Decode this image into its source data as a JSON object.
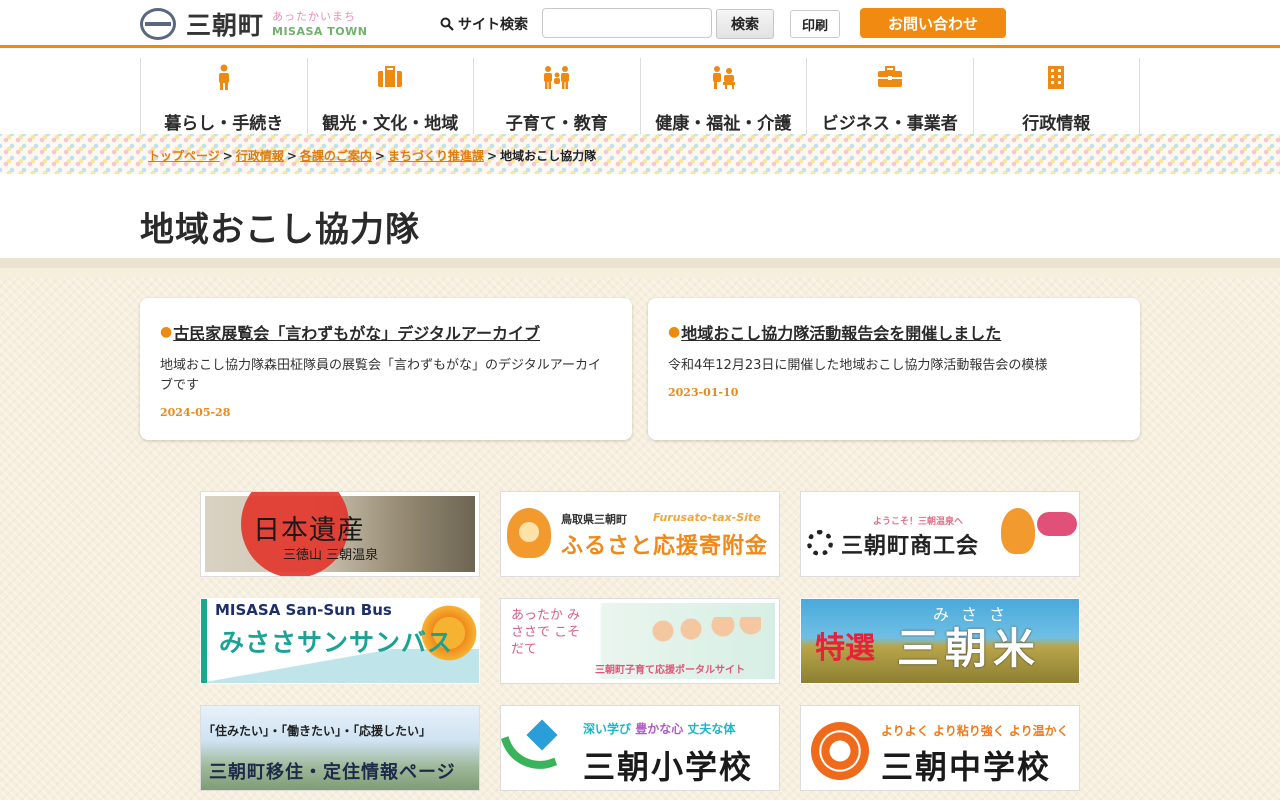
{
  "header": {
    "logo_name": "三朝町",
    "logo_tag_jp": "あったかいまち",
    "logo_tag_en": "MISASA TOWN",
    "search_label": "サイト検索",
    "search_value": "",
    "search_placeholder": "",
    "search_button": "検索",
    "print_button": "印刷",
    "contact_button": "お問い合わせ"
  },
  "gnav": {
    "items": [
      {
        "label": "暮らし・手続き",
        "icon": "person-icon"
      },
      {
        "label": "観光・文化・地域",
        "icon": "suitcase-icon"
      },
      {
        "label": "子育て・教育",
        "icon": "parent-child-icon"
      },
      {
        "label": "健康・福祉・介護",
        "icon": "care-icon"
      },
      {
        "label": "ビジネス・事業者",
        "icon": "briefcase-icon"
      },
      {
        "label": "行政情報",
        "icon": "building-icon"
      }
    ]
  },
  "breadcrumb": {
    "items": [
      "トップページ",
      "行政情報",
      "各課のご案内",
      "まちづくり推進課"
    ],
    "current": "地域おこし協力隊",
    "separator": ">"
  },
  "page": {
    "title": "地域おこし協力隊"
  },
  "cards": [
    {
      "title": "古民家展覧会「言わずもがな」デジタルアーカイブ",
      "description": "地域おこし協力隊森田柾隊員の展覧会「言わずもがな」のデジタルアーカイブです",
      "date": "2024-05-28"
    },
    {
      "title": "地域おこし協力隊活動報告会を開催しました",
      "description": "令和4年12月23日に開催した地域おこし協力隊活動報告会の模様",
      "date": "2023-01-10"
    }
  ],
  "banners": {
    "heritage": {
      "main": "日本遺産",
      "sub": "三徳山 三朝温泉"
    },
    "furusato": {
      "l1": "鳥取県三朝町",
      "l1b": "Furusato-tax-Site",
      "l2": "ふるさと応援寄附金"
    },
    "shoukokai": {
      "top": "ようこそ！三朝温泉へ",
      "name": "三朝町商工会"
    },
    "bus": {
      "en": "MISASA San-Sun Bus",
      "jp": "みささサンサンバス"
    },
    "kosodate": {
      "l": "あったか みささで こそだて",
      "cap": "三朝町子育て応援ポータルサイト"
    },
    "rice": {
      "ruby": "みささ",
      "tok": "特選",
      "main": "三朝米"
    },
    "iju": {
      "l1": "「住みたい」・「働きたい」・「応援したい」",
      "l2": "三朝町移住・定住情報ページ"
    },
    "shogakko": {
      "motto_a": "深い学び",
      "motto_b": "豊かな心",
      "motto_c": "丈夫な体",
      "name": "三朝小学校"
    },
    "chugakko": {
      "motto": "よりよく より粘り強く より温かく",
      "name": "三朝中学校"
    }
  },
  "colors": {
    "accent": "#ee8a12",
    "link": "#e07c09",
    "date": "#e88a1d",
    "background": "#f6efde"
  }
}
